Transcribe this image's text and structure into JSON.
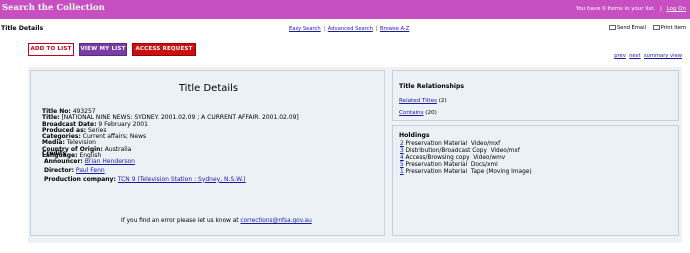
{
  "header": {
    "title": "Search the Collection",
    "cart_text": "You have 0 Items in your list.",
    "divider": "|",
    "logout": "Log On"
  },
  "subheader": {
    "page_title": "Title Details",
    "links": [
      {
        "label": "Easy Search"
      },
      {
        "label": "Advanced Search"
      },
      {
        "label": "Browse A-Z"
      }
    ],
    "separator": "|",
    "actions": [
      {
        "label": "Send Email",
        "icon": "email-icon"
      },
      {
        "label": "Print Item",
        "icon": "print-icon"
      }
    ]
  },
  "buttons": {
    "add": "ADD TO LIST",
    "view": "VIEW MY LIST",
    "access": "ACCESS REQUEST"
  },
  "pager": {
    "prev": "prev",
    "next": "next",
    "summary": "summary view"
  },
  "details": {
    "heading": "Title Details",
    "fields": [
      {
        "label": "Title No:",
        "value": "493257"
      },
      {
        "label": "Title:",
        "value": "[NATIONAL NINE NEWS: SYDNEY. 2001.02.09 ; A CURRENT AFFAIR. 2001.02.09]"
      },
      {
        "label": "Broadcast Date:",
        "value": "9 February 2001"
      },
      {
        "label": "Produced as:",
        "value": "Series"
      },
      {
        "label": "Categories:",
        "value": "Current affairs; News"
      },
      {
        "label": "Media:",
        "value": "Television"
      },
      {
        "label": "Country of Origin:",
        "value": "Australia"
      },
      {
        "label": "Language:",
        "value": "English"
      }
    ],
    "credits_heading": "Credits",
    "credits": [
      {
        "label": "Announcer:",
        "value": "Brian Henderson"
      },
      {
        "label": "Director:",
        "value": "Paul Fenn"
      },
      {
        "label": "Production company:",
        "value": "TCN 9 (Television Station : Sydney, N.S.W.)"
      }
    ],
    "error_text": "If you find an error please let us know at",
    "error_email": "corrections@nfsa.gov.au"
  },
  "relationships": {
    "heading": "Title Relationships",
    "items": [
      {
        "label": "Related Titles",
        "count": "(2)"
      },
      {
        "label": "Contains",
        "count": "(20)"
      }
    ]
  },
  "holdings": {
    "heading": "Holdings",
    "items": [
      {
        "count": "2",
        "text": "Preservation Material  Video/mxf"
      },
      {
        "count": "3",
        "text": "Distribution/Broadcast Copy  Video/mxf"
      },
      {
        "count": "4",
        "text": "Access/Browsing copy  Video/wmv"
      },
      {
        "count": "5",
        "text": "Preservation Material  Docs/xml"
      },
      {
        "count": "1",
        "text": "Preservation Material  Tape (Moving Image)"
      }
    ]
  }
}
